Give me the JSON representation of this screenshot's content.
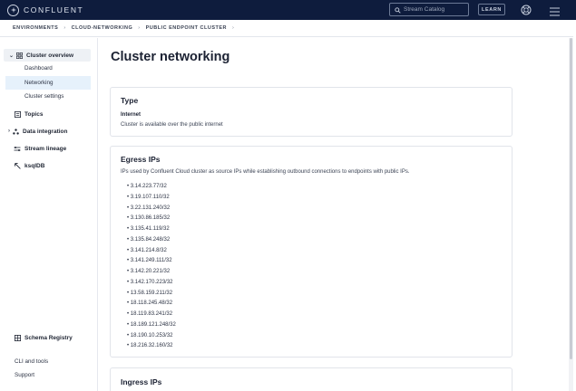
{
  "topbar": {
    "brand": "CONFLUENT",
    "search_placeholder": "Stream Catalog",
    "learn_label": "LEARN"
  },
  "breadcrumb": [
    "ENVIRONMENTS",
    "CLOUD-NETWORKING",
    "PUBLIC ENDPOINT CLUSTER"
  ],
  "sidebar": {
    "cluster_overview": "Cluster overview",
    "sub_items": [
      "Dashboard",
      "Networking",
      "Cluster settings"
    ],
    "items": [
      "Topics",
      "Data integration",
      "Stream lineage",
      "ksqlDB"
    ],
    "schema_registry": "Schema Registry",
    "footer": [
      "CLI and tools",
      "Support"
    ]
  },
  "main": {
    "title": "Cluster networking",
    "type_card": {
      "heading": "Type",
      "label": "Internet",
      "description": "Cluster is available over the public internet"
    },
    "egress_card": {
      "heading": "Egress IPs",
      "description": "IPs used by Confluent Cloud cluster as source IPs while establishing outbound connections to endpoints with public IPs.",
      "ips": [
        "3.14.223.77/32",
        "3.19.107.110/32",
        "3.22.131.240/32",
        "3.130.86.185/32",
        "3.135.41.119/32",
        "3.135.84.248/32",
        "3.141.214.8/32",
        "3.141.249.111/32",
        "3.142.20.221/32",
        "3.142.170.223/32",
        "13.58.159.211/32",
        "18.118.245.48/32",
        "18.119.83.241/32",
        "18.189.121.248/32",
        "18.190.10.253/32",
        "18.216.32.160/32"
      ]
    },
    "ingress_card": {
      "heading": "Ingress IPs"
    }
  },
  "colors": {
    "topbar": "#0e1c3d",
    "active_nav": "#e6f1fb",
    "card_border": "#e1e4ea"
  }
}
